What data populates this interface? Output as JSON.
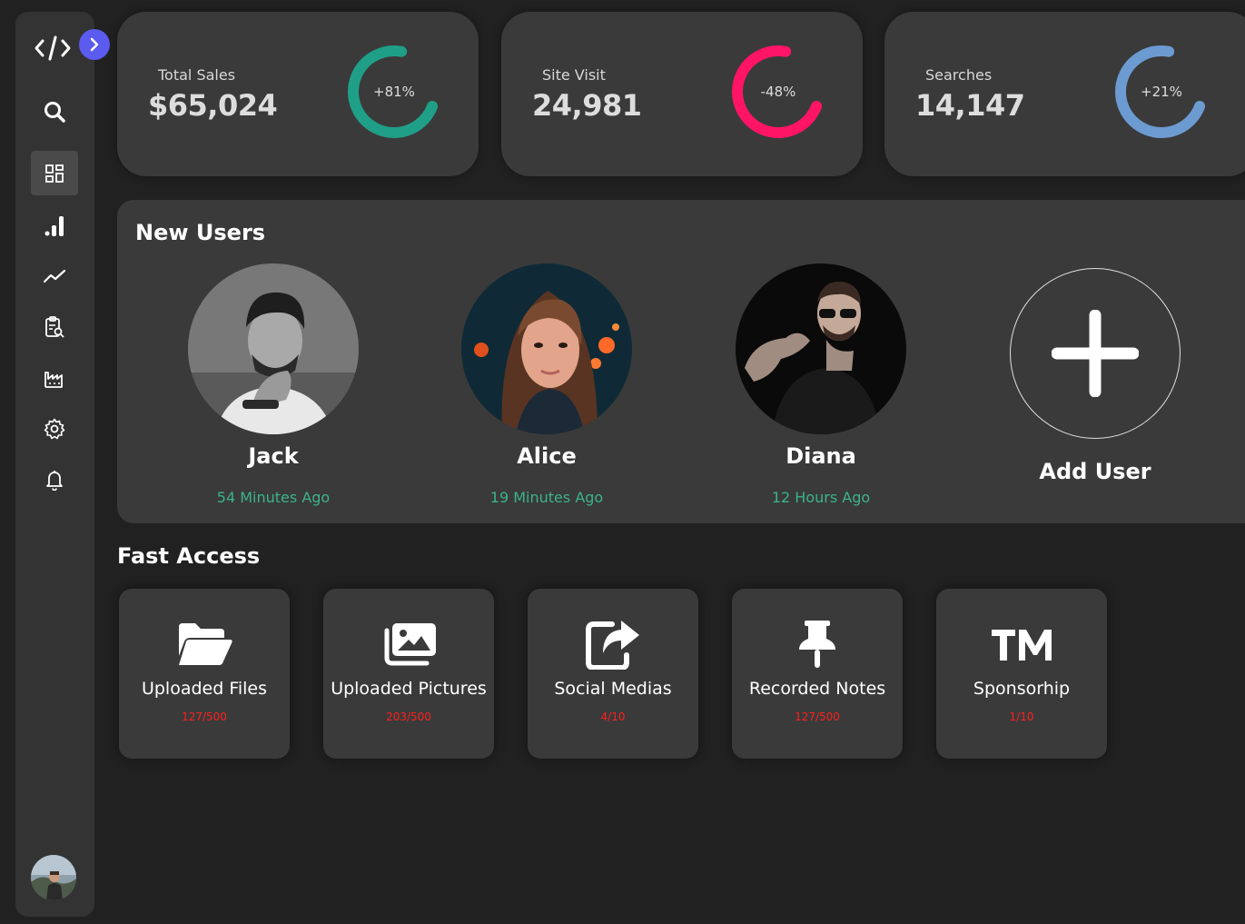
{
  "sidebar": {
    "icons": [
      "code-icon",
      "chevron-right-icon",
      "search-icon",
      "dashboard-icon",
      "signal-bars-icon",
      "trend-line-icon",
      "report-search-icon",
      "factory-icon",
      "settings-icon",
      "bell-icon"
    ]
  },
  "stats": [
    {
      "label": "Total Sales",
      "value": "$65,024",
      "change": "+81%",
      "color": "#1f9f88",
      "percent": 81
    },
    {
      "label": "Site Visit",
      "value": "24,981",
      "change": "-48%",
      "color": "#ff1466",
      "percent": 48
    },
    {
      "label": "Searches",
      "value": "14,147",
      "change": "+21%",
      "color": "#6c9bd2",
      "percent": 21
    }
  ],
  "new_users": {
    "title": "New Users",
    "users": [
      {
        "name": "Jack",
        "time": "54 Minutes Ago"
      },
      {
        "name": "Alice",
        "time": "19 Minutes Ago"
      },
      {
        "name": "Diana",
        "time": "12 Hours Ago"
      }
    ],
    "add_label": "Add User"
  },
  "fast_access": {
    "title": "Fast Access",
    "items": [
      {
        "label": "Uploaded Files",
        "count": "127/500",
        "icon": "folder-open-icon"
      },
      {
        "label": "Uploaded Pictures",
        "count": "203/500",
        "icon": "images-icon"
      },
      {
        "label": "Social Medias",
        "count": "4/10",
        "icon": "share-icon"
      },
      {
        "label": "Recorded Notes",
        "count": "127/500",
        "icon": "thumbtack-icon"
      },
      {
        "label": "Sponsorhip",
        "count": "1/10",
        "icon": "trademark-icon"
      }
    ]
  },
  "colors": {
    "accent": "#5b5bf0",
    "success": "#3bb38a",
    "danger": "#ff1f1f"
  }
}
